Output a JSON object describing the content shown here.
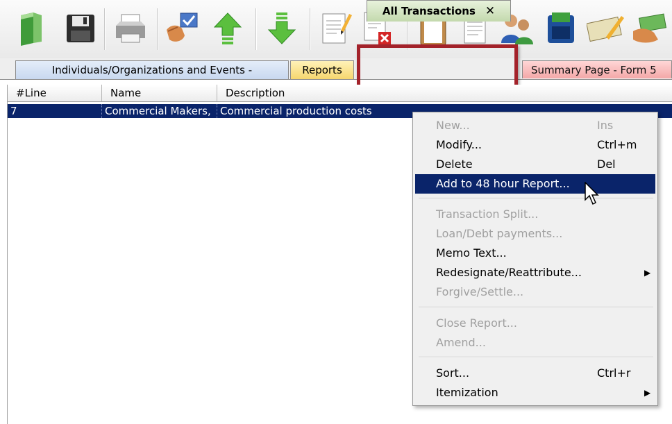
{
  "toolbar": {
    "buttons": [
      "open-folder-icon",
      "save-disk-icon",
      "printer-icon",
      "approve-hand-icon",
      "up-arrow-icon",
      "down-arrow-icon",
      "edit-document-icon",
      "delete-document-icon",
      "clipboard-icon",
      "report-document-icon",
      "people-icon",
      "cash-register-icon",
      "check-payment-icon",
      "money-hand-icon"
    ]
  },
  "tabs": {
    "individuals": "Individuals/Organizations and Events -",
    "reports": "Reports",
    "all_transactions": "All Transactions",
    "close": "✕",
    "summary": "Summary Page - Form 5"
  },
  "grid": {
    "columns": [
      "#Line",
      "Name",
      "Description"
    ],
    "rows": [
      {
        "line": "7",
        "name": "Commercial Makers,",
        "description": "Commercial production costs"
      }
    ]
  },
  "menu": {
    "new": {
      "label": "New...",
      "shortcut": "Ins"
    },
    "modify": {
      "label": "Modify...",
      "shortcut": "Ctrl+m"
    },
    "delete": {
      "label": "Delete",
      "shortcut": "Del"
    },
    "add48": {
      "label": "Add to 48 hour Report..."
    },
    "split": {
      "label": "Transaction Split..."
    },
    "loan": {
      "label": "Loan/Debt payments..."
    },
    "memo": {
      "label": "Memo Text..."
    },
    "redesignate": {
      "label": "Redesignate/Reattribute..."
    },
    "forgive": {
      "label": "Forgive/Settle..."
    },
    "close_report": {
      "label": "Close Report..."
    },
    "amend": {
      "label": "Amend..."
    },
    "sort": {
      "label": "Sort...",
      "shortcut": "Ctrl+r"
    },
    "itemization": {
      "label": "Itemization"
    }
  },
  "colors": {
    "selection": "#0a246a",
    "highlight_box": "#a3222a"
  }
}
